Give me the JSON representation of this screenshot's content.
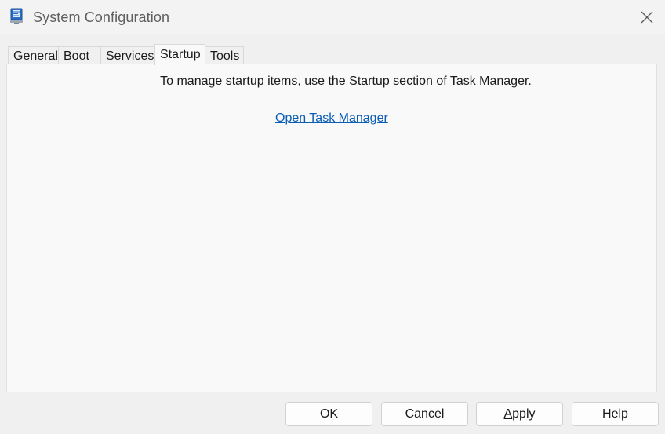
{
  "window": {
    "title": "System Configuration",
    "icon": "msconfig-app-icon",
    "close_icon": "close-icon"
  },
  "tabs": [
    {
      "label": "General",
      "active": false
    },
    {
      "label": "Boot",
      "active": false
    },
    {
      "label": "Services",
      "active": false
    },
    {
      "label": "Startup",
      "active": true
    },
    {
      "label": "Tools",
      "active": false
    }
  ],
  "startup_panel": {
    "message": "To manage startup items, use the Startup section of Task Manager.",
    "link_label": "Open Task Manager"
  },
  "buttons": {
    "ok": "OK",
    "cancel": "Cancel",
    "apply_mnemonic": "A",
    "apply_rest": "pply",
    "help": "Help"
  },
  "colors": {
    "link": "#0a5db5",
    "window_bg": "#f0f0f0",
    "panel_bg": "#f9f9f9"
  }
}
